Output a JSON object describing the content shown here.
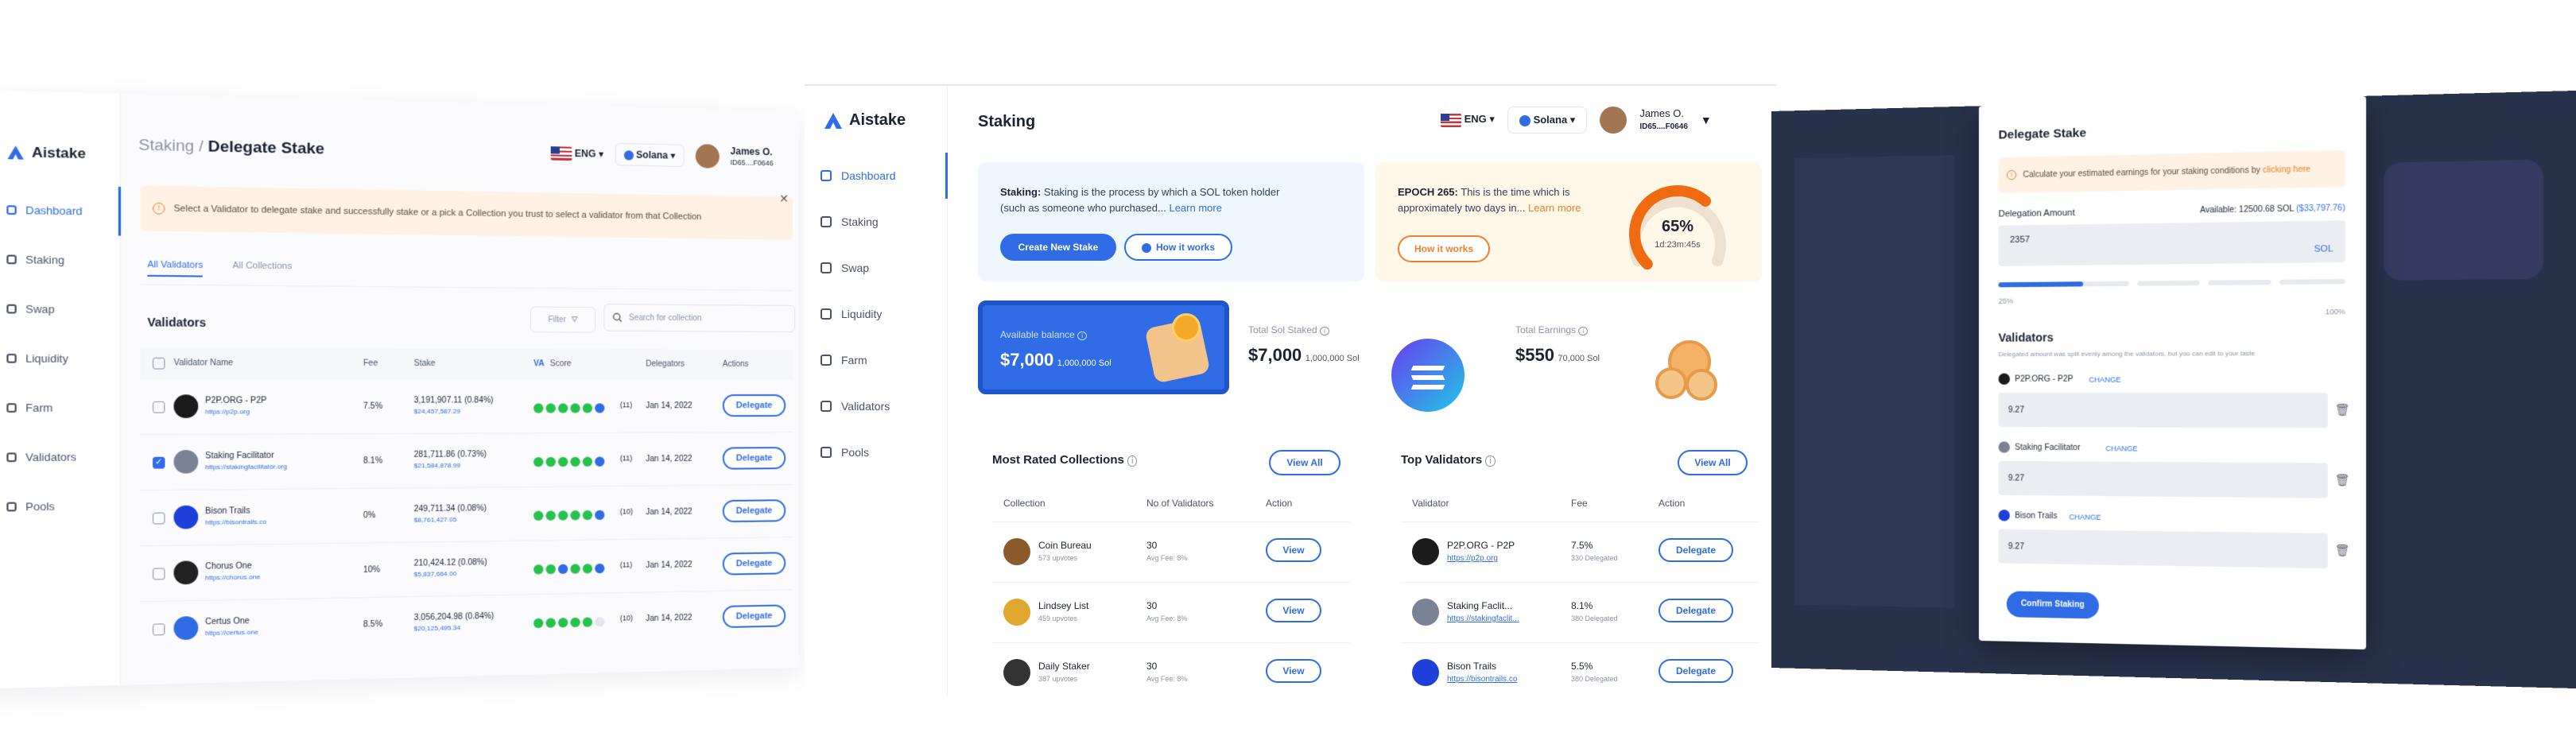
{
  "brand": "Aistake",
  "header": {
    "lang": "ENG",
    "network": "Solana",
    "user_name": "James O.",
    "user_id": "ID65....F0646"
  },
  "nav": [
    "Dashboard",
    "Staking",
    "Swap",
    "Liquidity",
    "Farm",
    "Validators",
    "Pools"
  ],
  "left": {
    "crumb_parent": "Staking /",
    "crumb_current": "Delegate Stake",
    "alert": "Select a Validator to delegate stake and successfully stake or a pick a Collection you trust to select a validator from that Collection",
    "tabs": [
      "All Validators",
      "All Collections"
    ],
    "section_title": "Validators",
    "filter_label": "Filter",
    "search_placeholder": "Search for collection",
    "columns": [
      "Validator Name",
      "Fee",
      "Stake",
      "Score",
      "Delegators",
      "Actions"
    ],
    "va_badge": "VA",
    "rows": [
      {
        "name": "P2P.ORG - P2P",
        "url": "https://p2p.org",
        "fee": "7.5%",
        "stake": "3,191,907.11 (0.84%)",
        "stake_usd": "$24,457,587.29",
        "score": "(11)",
        "date": "Jan 14, 2022",
        "action": "Delegate",
        "checked": false,
        "color": "#1b1b1b"
      },
      {
        "name": "Staking Facilitator",
        "url": "https://stakingfacilitator.org",
        "fee": "8.1%",
        "stake": "281,711.86 (0.73%)",
        "stake_usd": "$21,584,878.99",
        "score": "(11)",
        "date": "Jan 14, 2022",
        "action": "Delegate",
        "checked": true,
        "color": "#7a8296"
      },
      {
        "name": "Bison Trails",
        "url": "https://bisontrails.co",
        "fee": "0%",
        "stake": "249,711.34 (0.08%)",
        "stake_usd": "$8,761,427.05",
        "score": "(10)",
        "date": "Jan 14, 2022",
        "action": "Delegate",
        "checked": false,
        "color": "#1e40d8"
      },
      {
        "name": "Chorus One",
        "url": "https://chorus.one",
        "fee": "10%",
        "stake": "210,424.12 (0.08%)",
        "stake_usd": "$5,837,664.00",
        "score": "(11)",
        "date": "Jan 14, 2022",
        "action": "Delegate",
        "checked": false,
        "color": "#222222"
      },
      {
        "name": "Certus One",
        "url": "https://certus.one",
        "fee": "8.5%",
        "stake": "3,056,204.98 (0.84%)",
        "stake_usd": "$20,125,495.34",
        "score": "(10)",
        "date": "Jan 14, 2022",
        "action": "Delegate",
        "checked": false,
        "color": "#2f6ce5"
      }
    ]
  },
  "mid": {
    "page_title": "Staking",
    "staking_card": {
      "bold": "Staking:",
      "text": "Staking is the process by which a SOL token holder (such as someone who purchased...",
      "link": "Learn more",
      "primary_btn": "Create New Stake",
      "secondary_btn": "How it works"
    },
    "epoch_card": {
      "bold": "EPOCH 265:",
      "text": "This is the time which is approximately two days in...",
      "link": "Learn more",
      "btn": "How it works",
      "percent_text": "65%",
      "percent": 0.65,
      "time": "1d:23m:45s"
    },
    "balance": {
      "label": "Available balance",
      "usd": "$7,000",
      "sol": "1,000,000 Sol"
    },
    "total_staked": {
      "label": "Total Sol Staked",
      "usd": "$7,000",
      "sol": "1,000,000 Sol"
    },
    "earnings": {
      "label": "Total Earnings",
      "usd": "$550",
      "sol": "70,000 Sol"
    },
    "collections": {
      "title": "Most Rated Collections",
      "view_all": "View All",
      "columns": [
        "Collection",
        "No of Validators",
        "Action"
      ],
      "rows": [
        {
          "name": "Coin Bureau",
          "sub": "573 upvotes",
          "count": "30",
          "fee": "Avg Fee: 8%",
          "action": "View",
          "color": "#8a5a2b"
        },
        {
          "name": "Lindsey List",
          "sub": "459 upvotes",
          "count": "30",
          "fee": "Avg Fee: 8%",
          "action": "View",
          "color": "#e0a82e"
        },
        {
          "name": "Daily Staker",
          "sub": "387 upvotes",
          "count": "30",
          "fee": "Avg Fee: 8%",
          "action": "View",
          "color": "#333333"
        }
      ]
    },
    "top_validators": {
      "title": "Top Validators",
      "view_all": "View All",
      "columns": [
        "Validator",
        "Fee",
        "Action"
      ],
      "rows": [
        {
          "name": "P2P.ORG - P2P",
          "url": "https://p2p.org",
          "fee": "7.5%",
          "delegated": "330 Delegated",
          "action": "Delegate",
          "color": "#1b1b1b"
        },
        {
          "name": "Staking Faclit...",
          "url": "https://stakingfaclit...",
          "fee": "8.1%",
          "delegated": "380 Delegated",
          "action": "Delegate",
          "color": "#7a8296"
        },
        {
          "name": "Bison Trails",
          "url": "https://bisontrails.co",
          "fee": "5.5%",
          "delegated": "380 Delegated",
          "action": "Delegate",
          "color": "#1e40d8"
        }
      ]
    }
  },
  "modal": {
    "title": "Delegate Stake",
    "alert_text": "Calculate your estimated earnings for your staking conditions by",
    "alert_link": "clicking here",
    "amount_label": "Delegation Amount",
    "available": "Available: 12500.68 SOL",
    "available_usd": "($33,797.76)",
    "amount_value": "2357",
    "currency": "SOL",
    "progress": 0.25,
    "min_label": "25%",
    "max_label": "100%",
    "validators_title": "Validators",
    "validators_note": "Delegated amount was split evenly among the validators, but you can edit to your taste",
    "change_label": "CHANGE",
    "items": [
      {
        "name": "P2P.ORG - P2P",
        "value": "9.27",
        "color": "#1b1b1b"
      },
      {
        "name": "Staking Facilitator",
        "value": "9.27",
        "color": "#7a8296"
      },
      {
        "name": "Bison Trails",
        "value": "9.27",
        "color": "#1e40d8"
      }
    ],
    "confirm": "Confirm Staking"
  }
}
